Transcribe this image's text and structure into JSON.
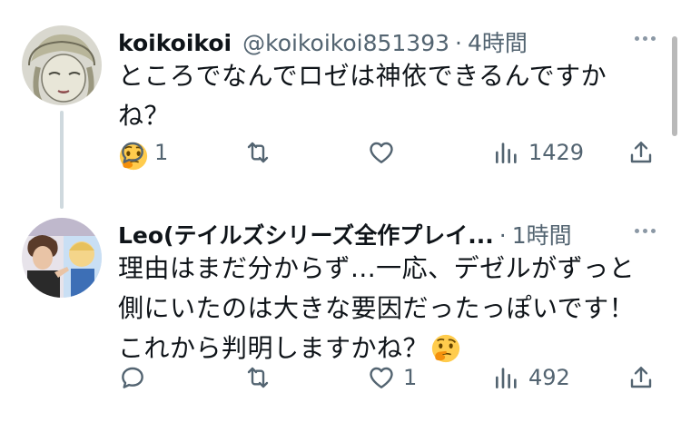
{
  "tweets": [
    {
      "name": "koikoikoi",
      "handle": "@koikoikoi851393",
      "separator": "·",
      "time": "4時間",
      "text": "ところでなんでロゼは神依できるんですかね？",
      "emoji": "thinking-face",
      "replies": "1",
      "retweets": "",
      "likes": "",
      "views": "1429"
    },
    {
      "name": "Leo(テイルズシリーズ全作プレイ...",
      "handle": "",
      "separator": "·",
      "time": "1時間",
      "lines": [
        "理由はまだ分からず...一応、デゼルがずっと",
        "側にいたのは大きな要因だったっぽいです！",
        "これから判明しますかね？"
      ],
      "emoji": "thinking-face",
      "replies": "",
      "retweets": "",
      "likes": "1",
      "views": "492"
    }
  ],
  "colors": {
    "text": "#0f1419",
    "secondary": "#536471",
    "thread_line": "#cfd9de",
    "background": "#ffffff"
  }
}
